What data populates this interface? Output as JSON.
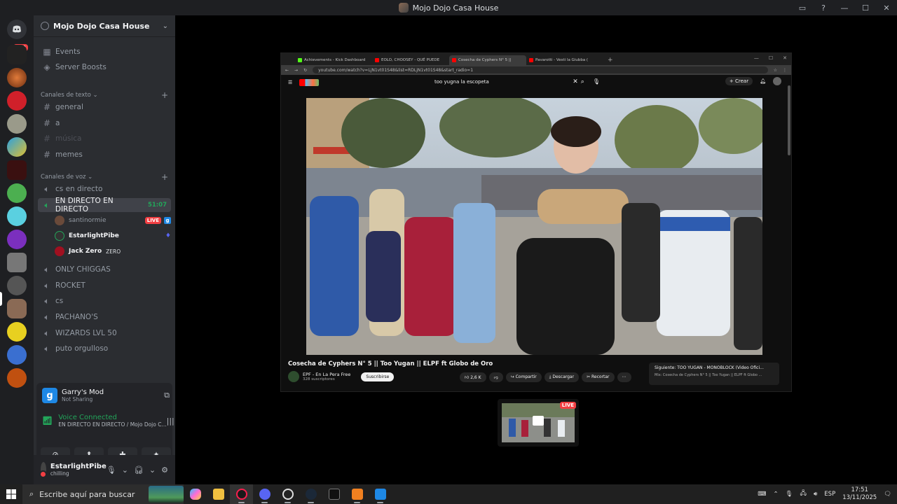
{
  "window": {
    "title": "Mojo Dojo Casa House"
  },
  "rail": {
    "badge": "500"
  },
  "server": {
    "name": "Mojo Dojo Casa House",
    "menu": [
      {
        "label": "Events",
        "icon": "calendar-icon"
      },
      {
        "label": "Server Boosts",
        "icon": "boost-icon"
      }
    ],
    "text_category": "Canales de texto",
    "text_channels": [
      "general",
      "a",
      "música",
      "memes"
    ],
    "voice_category": "Canales de voz",
    "voice_channels": [
      "cs en directo",
      "EN DIRECTO EN DIRECTO",
      "ONLY CHIGGAS",
      "ROCKET",
      "cs",
      "PACHANO'S",
      "WIZARDS LVL 50",
      "puto orgulloso"
    ],
    "active_timer": "51:07",
    "voice_users": [
      {
        "name": "santinormie",
        "badge": "LIVE"
      },
      {
        "name": "EstarlightPibe"
      },
      {
        "name": "Jack Zero",
        "tag": "ZERO"
      }
    ]
  },
  "activity": {
    "game": "Garry's Mod",
    "status": "Not Sharing"
  },
  "voice": {
    "status": "Voice Connected",
    "location": "EN DIRECTO EN DIRECTO / Mojo Dojo C..."
  },
  "user": {
    "name": "EstarlightPibe",
    "status": "chilling"
  },
  "browser": {
    "tabs": [
      {
        "label": "Achievements - Kick Dashboard",
        "color": "#53fc18"
      },
      {
        "label": "EOLO, CHOOSEY - QUÉ PUEDE",
        "color": "#ff0000"
      },
      {
        "label": "Cosecha de Cyphers N° 5 ||",
        "color": "#ff0000"
      },
      {
        "label": "Pavarotti - Vesti la Giubba (",
        "color": "#ff0000"
      }
    ],
    "url": "youtube.com/watch?v=LjN1vt01S48&list=RDLjN1vt01S48&start_radio=1"
  },
  "youtube": {
    "search": "too yugna la escopeta",
    "create": "Crear",
    "video_title": "Cosecha de Cyphers N° 5 || Too Yugan || ELPF ft Globo de Oro",
    "channel": "EPF - En La Pera Free",
    "subscribers": "328 suscriptores",
    "subscribe": "Suscribirse",
    "likes": "2,6 K",
    "share": "Compartir",
    "download": "Descargar",
    "clip": "Recortar",
    "next_label": "Siguiente: TOO YUGAN - MONOBLOCK (Video Ofici...",
    "mix_label": "Mix: Cosecha de Cyphers N° 5 || Too Yugan || ELPF ft Globo ..."
  },
  "preview": {
    "badge": "LIVE"
  },
  "taskbar": {
    "search_placeholder": "Escribe aquí para buscar",
    "lang": "ESP",
    "time": "17:51",
    "date": "13/11/2025"
  }
}
